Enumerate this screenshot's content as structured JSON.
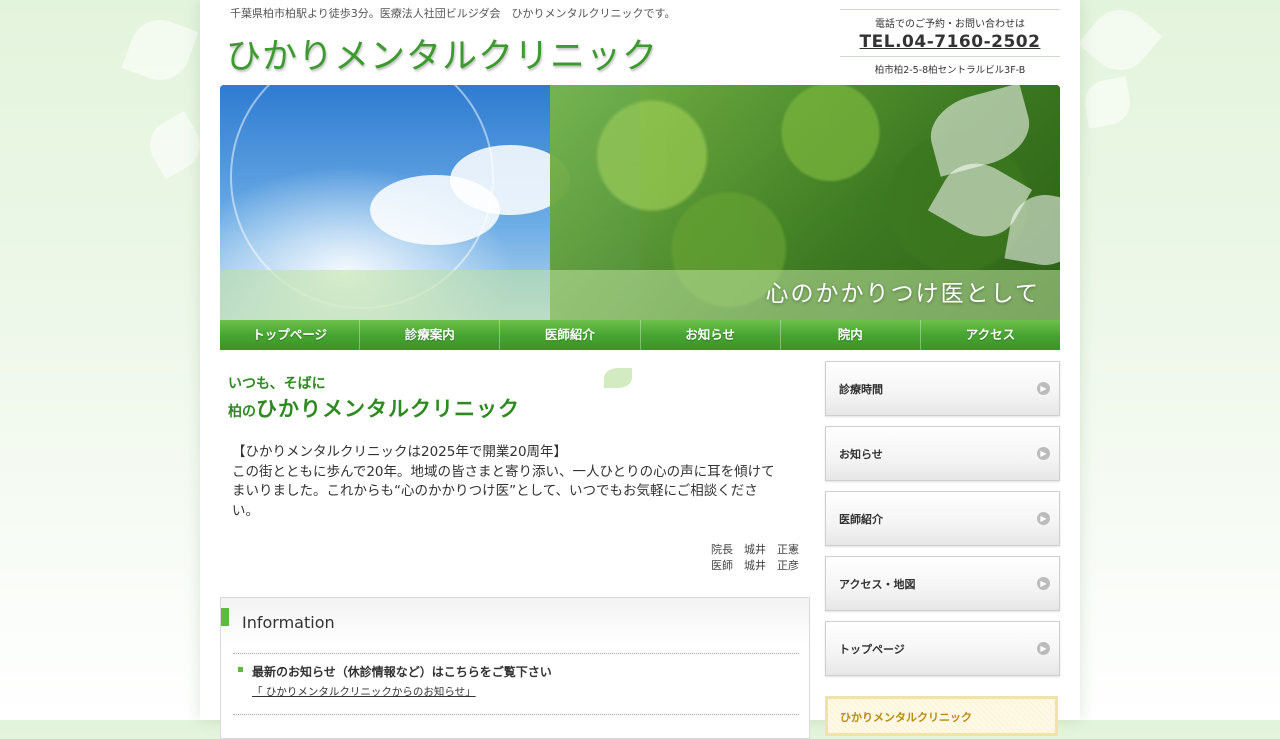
{
  "header": {
    "tagline": "千葉県柏市柏駅より徒歩3分。医療法人社団ビルジダ会　ひかりメンタルクリニックです。",
    "logo_text": "ひかりメンタルクリニック",
    "tel_label": "電話でのご予約・お問い合わせは",
    "tel": "TEL.04-7160-2502",
    "address": "柏市柏2-5-8柏セントラルビル3F-B"
  },
  "hero": {
    "slogan": "心のかかりつけ医として"
  },
  "nav": {
    "items": [
      "トップページ",
      "診療案内",
      "医師紹介",
      "お知らせ",
      "院内",
      "アクセス"
    ]
  },
  "intro": {
    "subtitle": "いつも、そばに",
    "title_prefix": "柏の",
    "title_main": "ひかりメンタルクリニック",
    "lines": [
      "【ひかりメンタルクリニックは2025年で開業20周年】",
      "この街とともに歩んで20年。地域の皆さまと寄り添い、一人ひとりの心の声に耳を傾けて",
      "まいりました。これからも“心のかかりつけ医”として、いつでもお気軽にご相談くださ",
      "い。"
    ],
    "signature": [
      "院長　城井　正憲",
      "医師　城井　正彦"
    ]
  },
  "information": {
    "heading": "Information",
    "news_title": "最新のお知らせ（休診情報など）はこちらをご覧下さい",
    "news_link": "「 ひかりメンタルクリニックからのお知らせ」"
  },
  "sidebar": {
    "buttons": [
      "診療時間",
      "お知らせ",
      "医師紹介",
      "アクセス・地図",
      "トップページ"
    ],
    "box_title": "ひかりメンタルクリニック"
  },
  "colors": {
    "brand_green": "#3c9a2e",
    "nav_green": "#48a532",
    "accent_gold": "#b98a12"
  },
  "icons": {
    "side_arrow": "arrow-right-circle-icon",
    "bullet": "green-square-bullet-icon"
  }
}
